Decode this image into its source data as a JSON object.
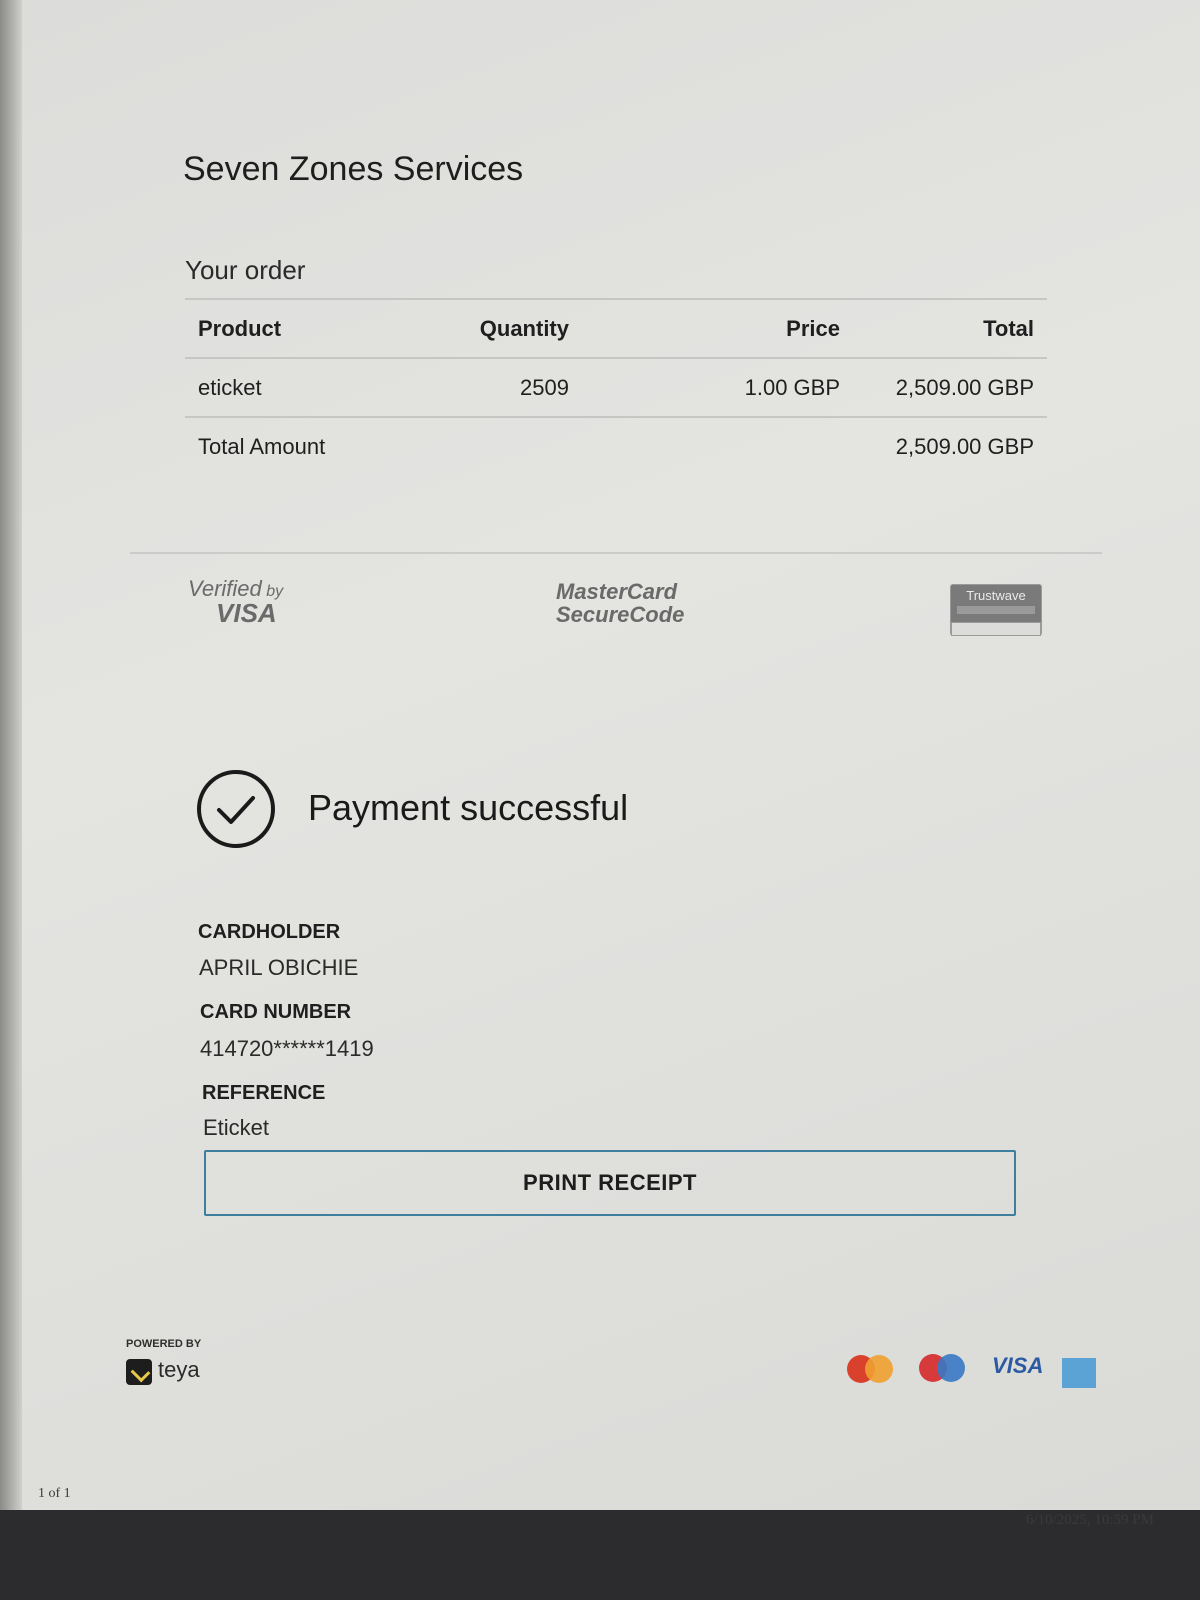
{
  "merchant": {
    "name": "Seven Zones Services"
  },
  "order": {
    "title": "Your order",
    "headers": {
      "product": "Product",
      "quantity": "Quantity",
      "price": "Price",
      "total": "Total"
    },
    "items": [
      {
        "product": "eticket",
        "quantity": "2509",
        "price": "1.00 GBP",
        "total": "2,509.00 GBP"
      }
    ],
    "total_label": "Total Amount",
    "total_value": "2,509.00 GBP"
  },
  "security_badges": {
    "visa_verified": {
      "line1": "Verified",
      "line1_suffix": "by",
      "line2": "VISA"
    },
    "mastercard": {
      "line1": "MasterCard",
      "line2": "SecureCode"
    },
    "trustwave": {
      "name": "Trustwave"
    }
  },
  "payment": {
    "status": "Payment successful"
  },
  "details": {
    "cardholder_label": "CARDHOLDER",
    "cardholder_value": "APRIL OBICHIE",
    "card_number_label": "CARD NUMBER",
    "card_number_value": "414720******1419",
    "reference_label": "REFERENCE",
    "reference_value": "Eticket"
  },
  "actions": {
    "print_label": "PRINT RECEIPT"
  },
  "footer": {
    "powered_by": "POWERED BY",
    "provider": "teya",
    "brand_visa": "VISA",
    "icons": [
      "mastercard-icon",
      "maestro-icon",
      "visa-logo",
      "amex-icon"
    ]
  },
  "print_meta": {
    "page_count": "1 of 1",
    "timestamp": "6/10/2025, 10:59 PM"
  },
  "colors": {
    "accent_border": "#3e7fa0",
    "paper": "#e0e0dd"
  }
}
